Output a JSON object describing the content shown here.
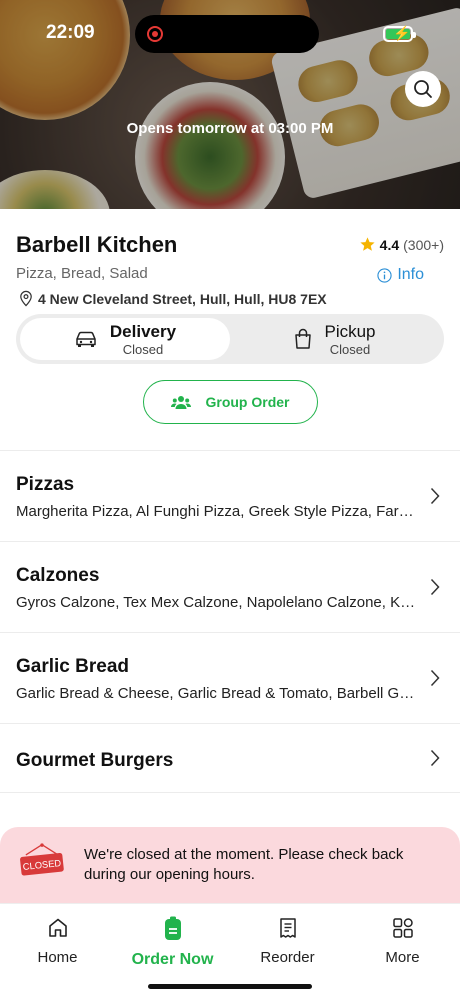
{
  "status_bar": {
    "time": "22:09"
  },
  "hero": {
    "opens_text": "Opens tomorrow at 03:00 PM"
  },
  "restaurant": {
    "name": "Barbell Kitchen",
    "rating": "4.4",
    "rating_count": "(300+)",
    "cuisine": "Pizza, Bread, Salad",
    "info_label": "Info",
    "address": "4 New Cleveland Street, Hull, Hull, HU8 7EX"
  },
  "fulfillment": {
    "delivery": {
      "label": "Delivery",
      "status": "Closed"
    },
    "pickup": {
      "label": "Pickup",
      "status": "Closed"
    }
  },
  "group_order_label": "Group Order",
  "categories": [
    {
      "title": "Pizzas",
      "items": "Margherita Pizza, Al Funghi Pizza, Greek Style Pizza, Farmhouse Pizza"
    },
    {
      "title": "Calzones",
      "items": "Gyros Calzone, Tex Mex Calzone, Napolelano Calzone, Kebab Calzone"
    },
    {
      "title": "Garlic Bread",
      "items": "Garlic Bread & Cheese, Garlic Bread & Tomato, Barbell Garlic Bread"
    },
    {
      "title": "Gourmet Burgers",
      "items": ""
    }
  ],
  "closed_banner": {
    "sign_text": "CLOSED",
    "message": "We're closed at the moment. Please check back during our opening hours."
  },
  "tabs": [
    {
      "label": "Home",
      "icon": "home-icon"
    },
    {
      "label": "Order Now",
      "icon": "order-icon"
    },
    {
      "label": "Reorder",
      "icon": "receipt-icon"
    },
    {
      "label": "More",
      "icon": "grid-icon"
    }
  ],
  "colors": {
    "accent": "#22b34c",
    "info": "#2b8fd6",
    "star": "#f5b400",
    "banner_bg": "#fbd9dd",
    "sign_red": "#d83a3a"
  }
}
